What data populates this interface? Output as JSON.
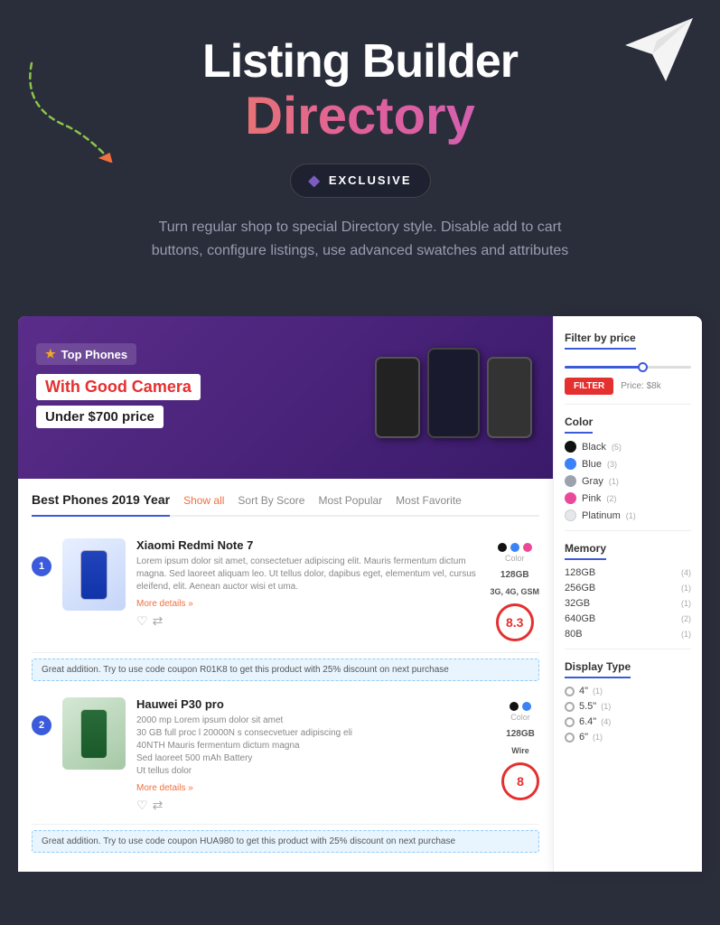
{
  "hero": {
    "title_top": "Listing Builder",
    "title_directory": "Directory",
    "badge_label": "EXCLUSIVE",
    "description": "Turn regular shop to special Directory style. Disable add to cart buttons, configure listings, use advanced swatches and attributes"
  },
  "banner": {
    "tag": "Top Phones",
    "headline": "With Good Camera",
    "subtitle": "Under $700 price"
  },
  "listing": {
    "title": "Best Phones 2019 Year",
    "tabs": [
      "Show all",
      "Sort By Score",
      "Most Popular",
      "Most Favorite"
    ],
    "products": [
      {
        "num": "1",
        "name": "Xiaomi Redmi Note 7",
        "description": "Lorem ipsum dolor sit amet, consectetuer adipiscing elit. Mauris fermentum dictum magna. Sed laoreet aliquam leo. Ut tellus dolor, dapibus eget, elementum vel, cursus eleifend, elit. Aenean auctor wisi et uma.",
        "more": "More details »",
        "storage": "128GB",
        "network": "3G, 4G, GSM",
        "score": "8.3",
        "promo": "Great addition. Try to use code coupon R01K8 to get this product with 25% discount on next purchase"
      },
      {
        "num": "2",
        "name": "Hauwei P30 pro",
        "description": "2000 mp Lorem ipsum dolor sit amet\n30 GB full proc l 20000N s consecvetuer adipiscing eli\n40NTH Mauris fermentum dictum magna\nSed laoreet 500 mAh Battery\nUt tellus dolor",
        "more": "More details »",
        "storage": "128GB",
        "network": "Wire",
        "score": "8",
        "promo": "Great addition. Try to use code coupon HUA980 to get this product with 25% discount on next purchase"
      }
    ]
  },
  "sidebar": {
    "filter_by_price": "Filter by price",
    "filter_btn": "FILTER",
    "price_text": "Price: $8k",
    "color_section": "Color",
    "colors": [
      {
        "name": "Black",
        "count": "(5)",
        "color": "#111111"
      },
      {
        "name": "Blue",
        "count": "(3)",
        "color": "#3b82f6"
      },
      {
        "name": "Gray",
        "count": "(1)",
        "color": "#9ca3af"
      },
      {
        "name": "Pink",
        "count": "(2)",
        "color": "#ec4899"
      },
      {
        "name": "Platinum",
        "count": "(1)",
        "color": "#e5e7eb"
      }
    ],
    "memory_section": "Memory",
    "memories": [
      {
        "label": "128GB",
        "count": "(4)"
      },
      {
        "label": "256GB",
        "count": "(1)"
      },
      {
        "label": "32GB",
        "count": "(1)"
      },
      {
        "label": "640GB",
        "count": "(2)"
      },
      {
        "label": "80B",
        "count": "(1)"
      }
    ],
    "display_section": "Display Type",
    "displays": [
      {
        "label": "4\"",
        "count": "(1)"
      },
      {
        "label": "5.5\"",
        "count": "(1)"
      },
      {
        "label": "6.4\"",
        "count": "(4)"
      },
      {
        "label": "6\"",
        "count": "(1)"
      }
    ]
  }
}
